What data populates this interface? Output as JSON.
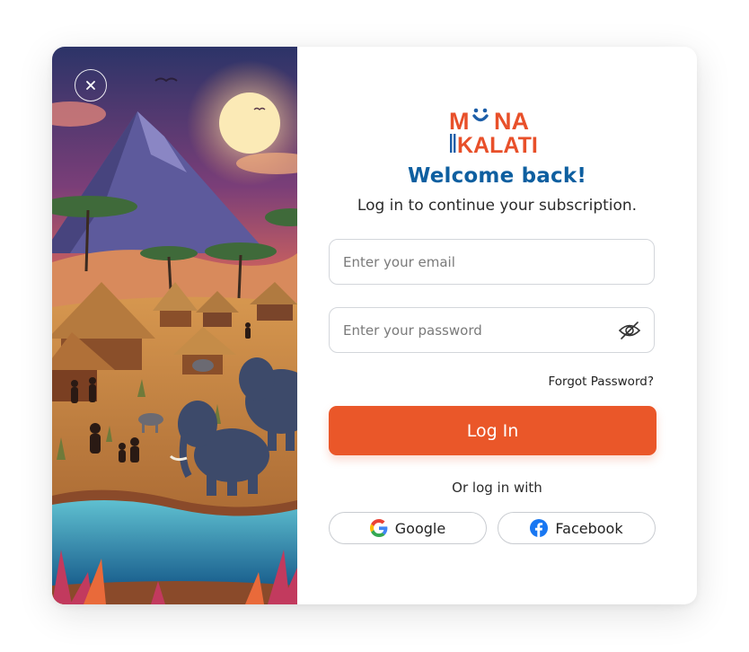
{
  "close": {
    "icon": "close-icon"
  },
  "logo": {
    "line1": "MUNA",
    "line2": "KALATI",
    "colors": {
      "orange": "#e8502a",
      "blue": "#1c5ea8"
    }
  },
  "header": {
    "title": "Welcome back!",
    "subtitle": "Log in to continue your subscription."
  },
  "form": {
    "email_placeholder": "Enter your email",
    "email_value": "",
    "password_placeholder": "Enter your password",
    "password_value": "",
    "password_toggle_icon": "eye-off-icon",
    "forgot_label": "Forgot Password?",
    "login_label": "Log In"
  },
  "social": {
    "divider_label": "Or log in with",
    "google_label": "Google",
    "google_icon": "google-icon",
    "facebook_label": "Facebook",
    "facebook_icon": "facebook-icon"
  },
  "colors": {
    "primary": "#ea5729",
    "heading": "#0e5fa0",
    "facebook": "#1877f2"
  }
}
